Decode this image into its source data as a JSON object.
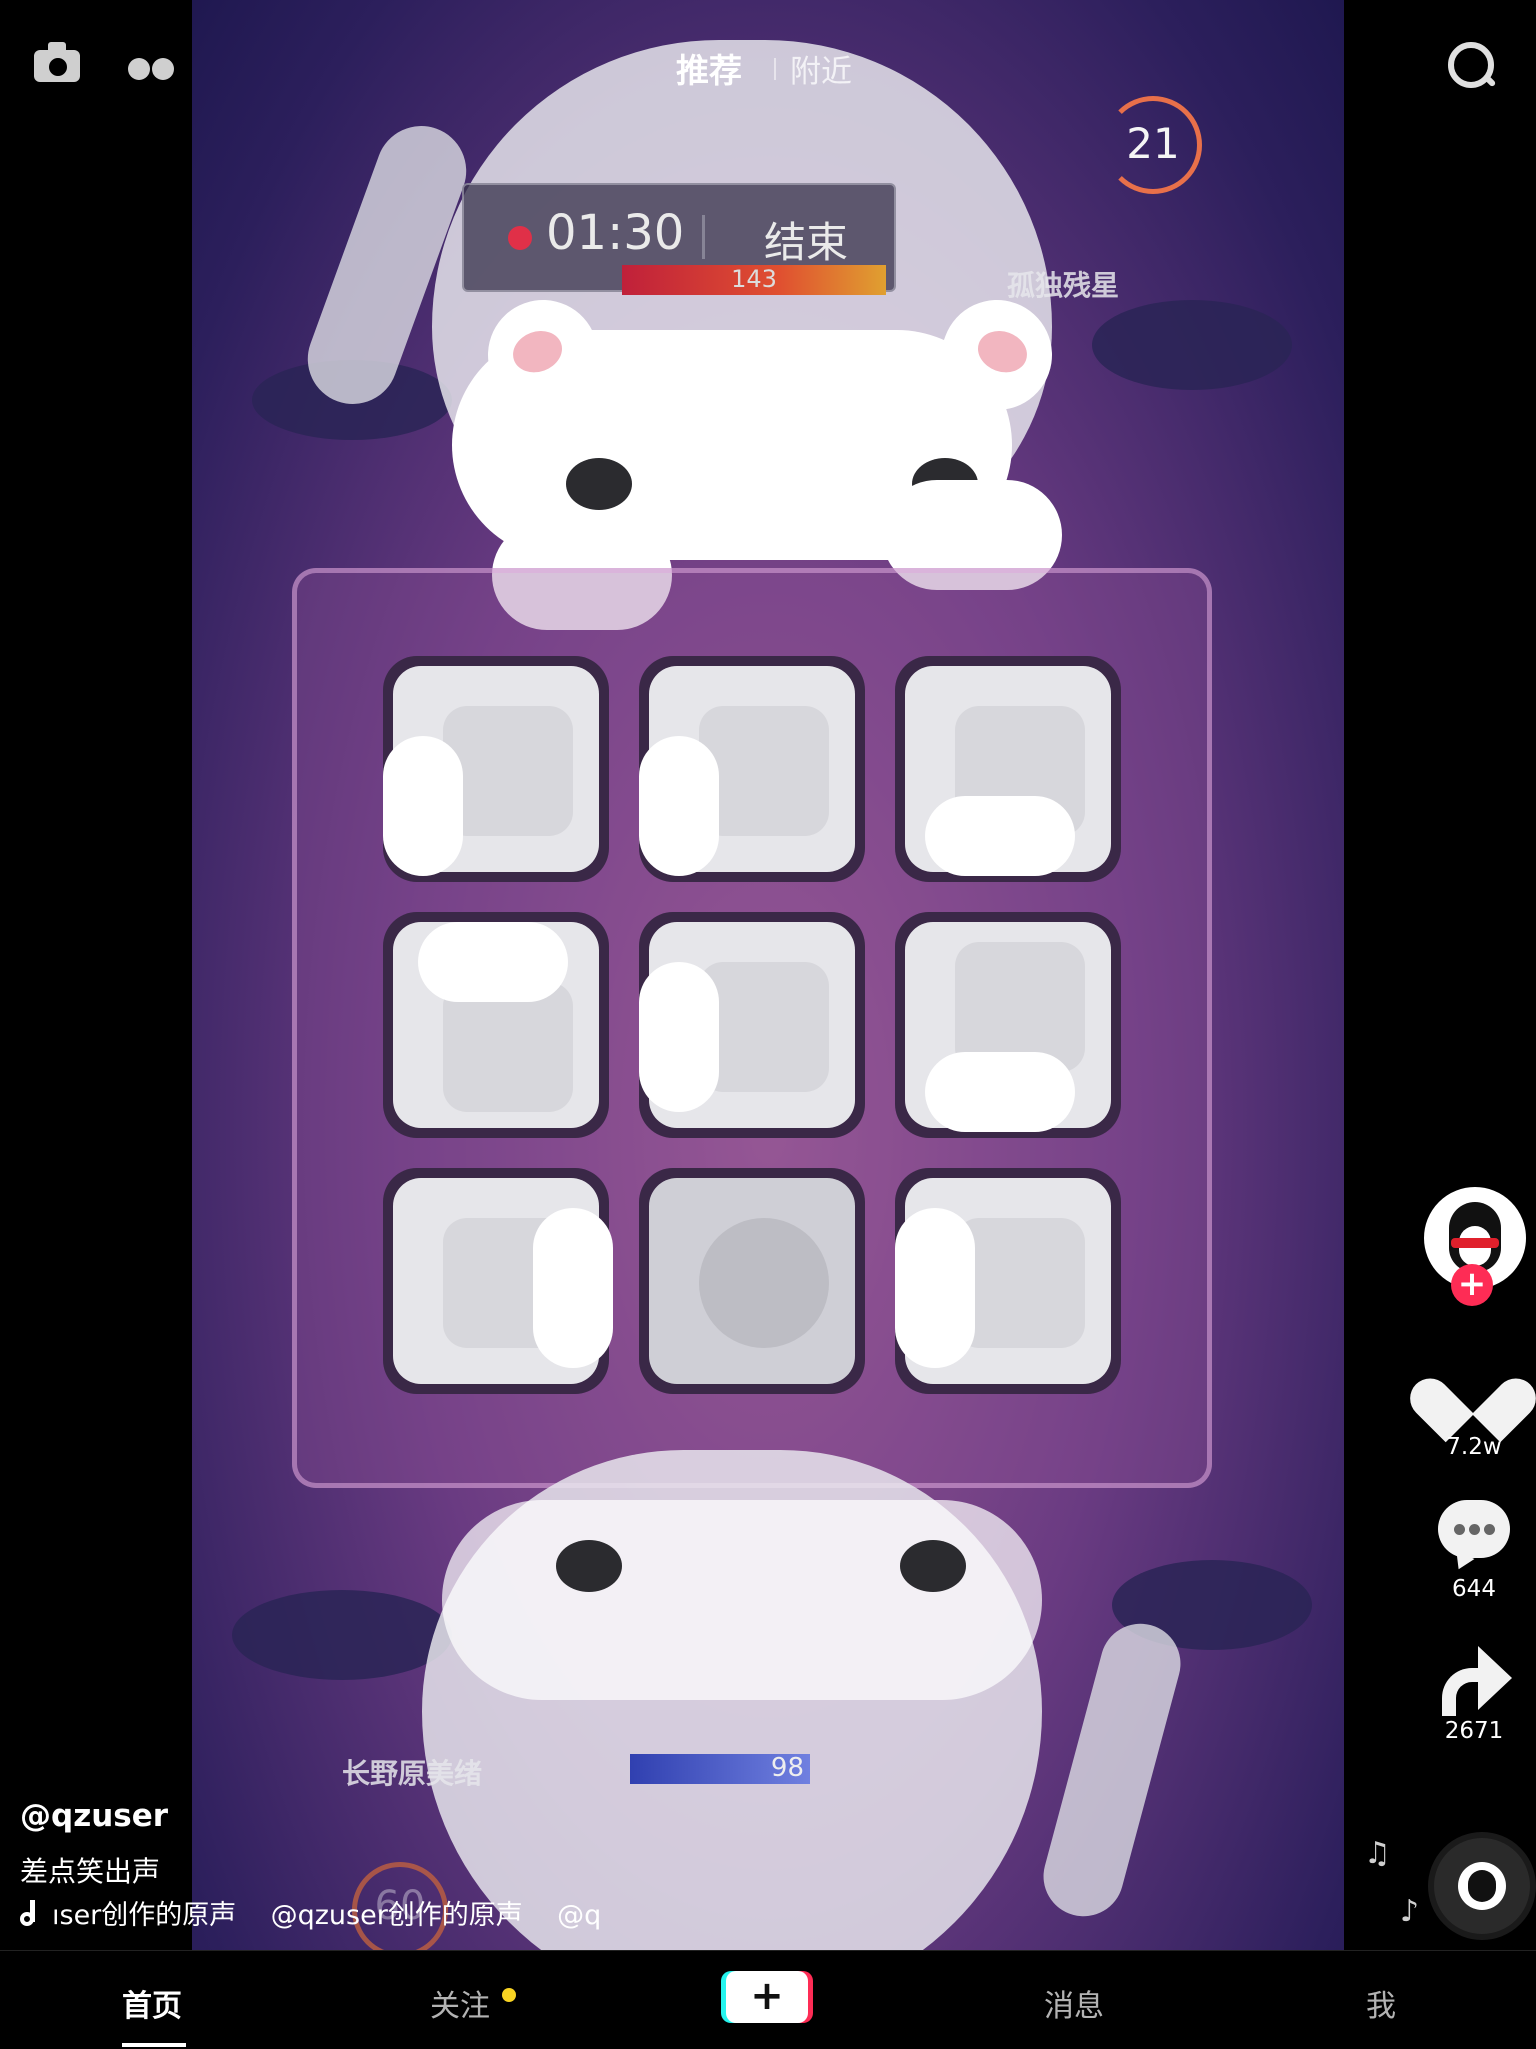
{
  "top_nav": {
    "tab_recommend": "推荐",
    "tab_nearby": "附近"
  },
  "game": {
    "timer_time": "01:30",
    "timer_end": "结束",
    "player_top_hp": "143",
    "player_top_name": "孤独残星",
    "level": "21",
    "player_bottom_name": "长野原美绪",
    "player_bottom_hp": "98",
    "round_timer": "60"
  },
  "sidebar": {
    "likes": "7.2w",
    "comments": "644",
    "shares": "2671",
    "follow_symbol": "+"
  },
  "caption": {
    "username": "@qzuser",
    "description": "差点笑出声",
    "music_marquee": "ıser创作的原声    @qzuser创作的原声    @q"
  },
  "bottom_nav": {
    "home": "首页",
    "follow": "关注",
    "create": "+",
    "messages": "消息",
    "me": "我"
  },
  "colors": {
    "accent_red": "#fe2c55",
    "accent_cyan": "#25f4ee",
    "notify_dot": "#f9d423"
  }
}
